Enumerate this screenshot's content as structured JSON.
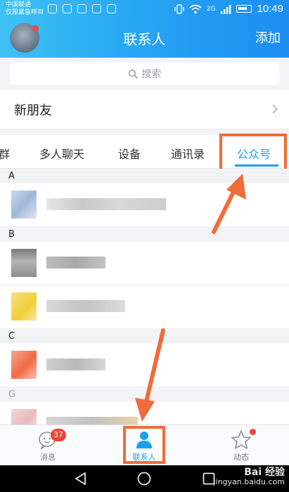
{
  "status_bar": {
    "carrier_line1": "中国联通",
    "carrier_line2": "仅限紧急呼叫",
    "network_label": "2G",
    "clock": "10:49"
  },
  "header": {
    "title": "联系人",
    "add_label": "添加"
  },
  "search": {
    "placeholder": "搜索"
  },
  "new_friends": {
    "label": "新朋友"
  },
  "tabs": [
    {
      "label": "群",
      "active": false
    },
    {
      "label": "多人聊天",
      "active": false
    },
    {
      "label": "设备",
      "active": false
    },
    {
      "label": "通讯录",
      "active": false
    },
    {
      "label": "公众号",
      "active": true
    }
  ],
  "contact_sections": [
    {
      "letter": "A",
      "rows": 1
    },
    {
      "letter": "B",
      "rows": 2
    },
    {
      "letter": "C",
      "rows": 1
    },
    {
      "letter": "G",
      "rows": 1
    }
  ],
  "bottom_nav": [
    {
      "label": "消息",
      "badge": "37",
      "active": false
    },
    {
      "label": "联系人",
      "active": true
    },
    {
      "label": "动态",
      "dot": true,
      "active": false
    }
  ],
  "watermark": {
    "brand": "Bai 经验",
    "url": "jingyan.baidu.com"
  },
  "colors": {
    "header_gradient_start": "#3ec1f5",
    "header_gradient_end": "#1d8df1",
    "accent": "#1aa0f0",
    "annotation": "#f26b3a",
    "badge": "#f24236"
  },
  "icons": {
    "search": "search-icon",
    "chevron": "chevron-right-icon",
    "messages": "chat-bubble-icon",
    "contacts": "person-icon",
    "moments": "star-icon",
    "back": "back-triangle-icon",
    "home": "home-circle-icon",
    "recents": "recents-square-icon"
  }
}
